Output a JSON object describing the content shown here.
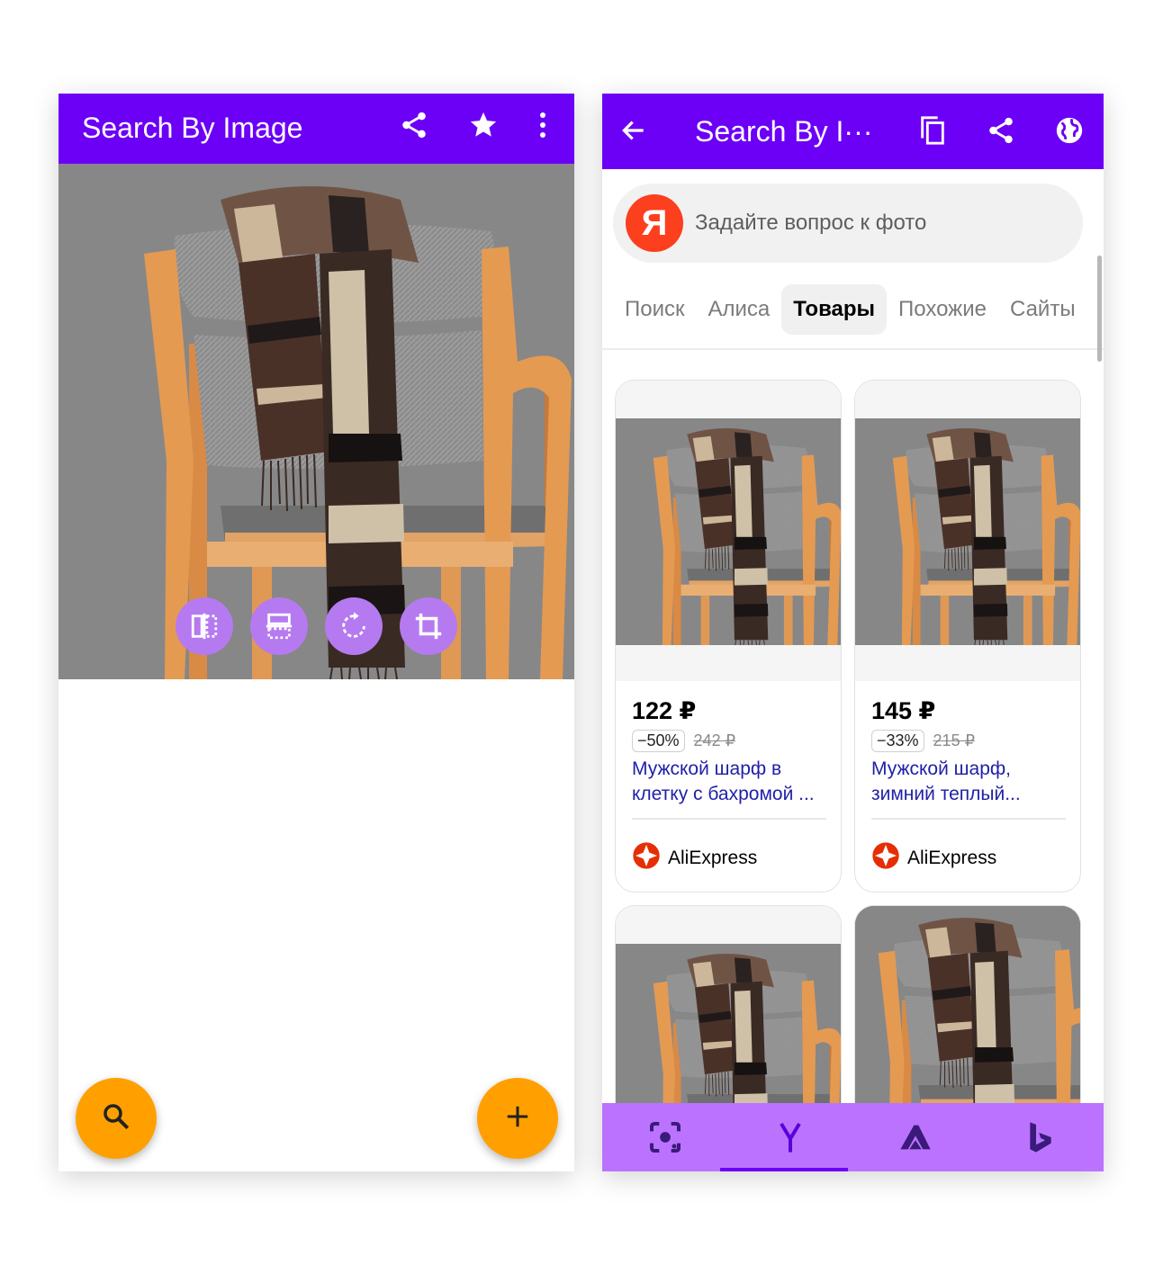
{
  "left_screen": {
    "app_title": "Search By Image",
    "toolbar_icons": [
      "share-icon",
      "star-icon",
      "more-vert-icon"
    ],
    "edit_tools": [
      "flip-horizontal-icon",
      "flip-vertical-icon",
      "rotate-icon",
      "crop-icon"
    ],
    "fab_left": "search-icon",
    "fab_right": "plus-icon"
  },
  "right_screen": {
    "app_title": "Search By I···",
    "toolbar_icons": [
      "back-arrow-icon",
      "copy-icon",
      "share-icon",
      "globe-icon"
    ],
    "search": {
      "logo": "Я",
      "placeholder": "Задайте вопрос к фото"
    },
    "tabs": [
      {
        "label": "Поиск",
        "active": false
      },
      {
        "label": "Алиса",
        "active": false
      },
      {
        "label": "Товары",
        "active": true
      },
      {
        "label": "Похожие",
        "active": false
      },
      {
        "label": "Сайты",
        "active": false
      }
    ],
    "products": [
      {
        "price": "122 ₽",
        "discount": "−50%",
        "old_price": "242 ₽",
        "title": "Мужской шарф в клетку с бахромой ...",
        "seller": "AliExpress"
      },
      {
        "price": "145 ₽",
        "discount": "−33%",
        "old_price": "215 ₽",
        "title": "Мужской шарф, зимний теплый...",
        "seller": "AliExpress"
      }
    ],
    "bottom_nav": [
      {
        "icon": "google-lens-icon",
        "active": false
      },
      {
        "icon": "yandex-icon",
        "active": true
      },
      {
        "icon": "tineye-icon",
        "active": false
      },
      {
        "icon": "bing-icon",
        "active": false
      }
    ]
  },
  "colors": {
    "app_bar": "#6c00f6",
    "fab": "#ffa000",
    "tool_buttons": "#b57af0",
    "bottom_nav": "#bb73ff",
    "link": "#1f1fa8",
    "yandex_red": "#fc3f1d"
  }
}
